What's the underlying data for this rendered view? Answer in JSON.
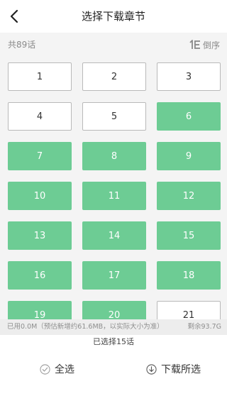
{
  "header": {
    "title": "选择下载章节"
  },
  "list": {
    "count_label": "共89话",
    "sort_label": "倒序"
  },
  "chapters": [
    {
      "label": "1",
      "selected": false
    },
    {
      "label": "2",
      "selected": false
    },
    {
      "label": "3",
      "selected": false
    },
    {
      "label": "4",
      "selected": false
    },
    {
      "label": "5",
      "selected": false
    },
    {
      "label": "6",
      "selected": true
    },
    {
      "label": "7",
      "selected": true
    },
    {
      "label": "8",
      "selected": true
    },
    {
      "label": "9",
      "selected": true
    },
    {
      "label": "10",
      "selected": true
    },
    {
      "label": "11",
      "selected": true
    },
    {
      "label": "12",
      "selected": true
    },
    {
      "label": "13",
      "selected": true
    },
    {
      "label": "14",
      "selected": true
    },
    {
      "label": "15",
      "selected": true
    },
    {
      "label": "16",
      "selected": true
    },
    {
      "label": "17",
      "selected": true
    },
    {
      "label": "18",
      "selected": true
    },
    {
      "label": "19",
      "selected": true
    },
    {
      "label": "20",
      "selected": true
    },
    {
      "label": "21",
      "selected": false
    }
  ],
  "storage": {
    "used_text": "已用0.0M（预估新增约61.6MB，以实际大小为准）",
    "free_text": "剩余93.7G"
  },
  "selection": {
    "count_text": "已选择15话"
  },
  "bottom": {
    "select_all_label": "全选",
    "download_label": "下载所选"
  },
  "colors": {
    "accent": "#6dcc94",
    "background": "#f4f4f4"
  }
}
